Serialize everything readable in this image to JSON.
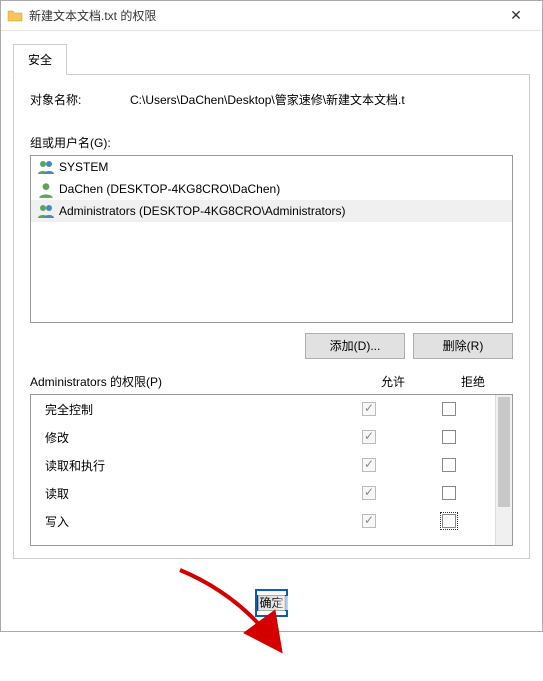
{
  "window": {
    "title": "新建文本文档.txt 的权限"
  },
  "tab": {
    "security": "安全"
  },
  "object": {
    "label": "对象名称:",
    "value": "C:\\Users\\DaChen\\Desktop\\管家速修\\新建文本文档.t"
  },
  "groups": {
    "label": "组或用户名(G):",
    "items": [
      {
        "label": "SYSTEM",
        "icon": "group"
      },
      {
        "label": "DaChen (DESKTOP-4KG8CRO\\DaChen)",
        "icon": "user"
      },
      {
        "label": "Administrators (DESKTOP-4KG8CRO\\Administrators)",
        "icon": "group"
      }
    ],
    "selected_index": 2
  },
  "buttons": {
    "add": "添加(D)...",
    "remove": "删除(R)",
    "ok": "确定"
  },
  "perm_header": {
    "title": "Administrators 的权限(P)",
    "allow": "允许",
    "deny": "拒绝"
  },
  "perms": [
    {
      "name": "完全控制",
      "allow": true,
      "deny": false
    },
    {
      "name": "修改",
      "allow": true,
      "deny": false
    },
    {
      "name": "读取和执行",
      "allow": true,
      "deny": false
    },
    {
      "name": "读取",
      "allow": true,
      "deny": false
    },
    {
      "name": "写入",
      "allow": true,
      "deny": false
    }
  ],
  "deny_focus_index": 4
}
